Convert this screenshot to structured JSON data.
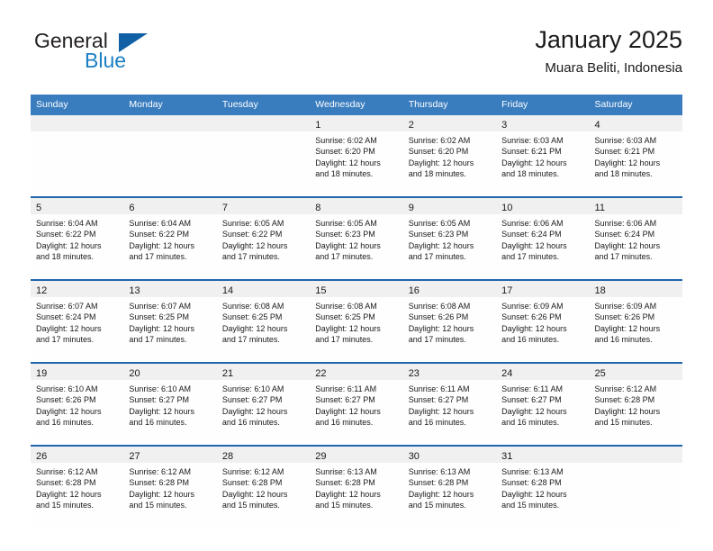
{
  "brand": {
    "name_top": "General",
    "name_bottom": "Blue",
    "accent_color": "#1160a6",
    "blue_text_color": "#1c7fc4"
  },
  "header": {
    "title": "January 2025",
    "subtitle": "Muara Beliti, Indonesia"
  },
  "calendar": {
    "header_bg": "#3a7dbf",
    "row_divider": "#1f64ad",
    "weekdays": [
      "Sunday",
      "Monday",
      "Tuesday",
      "Wednesday",
      "Thursday",
      "Friday",
      "Saturday"
    ],
    "weeks": [
      [
        {
          "day": "",
          "sunrise": "",
          "sunset": "",
          "daylight1": "",
          "daylight2": ""
        },
        {
          "day": "",
          "sunrise": "",
          "sunset": "",
          "daylight1": "",
          "daylight2": ""
        },
        {
          "day": "",
          "sunrise": "",
          "sunset": "",
          "daylight1": "",
          "daylight2": ""
        },
        {
          "day": "1",
          "sunrise": "Sunrise: 6:02 AM",
          "sunset": "Sunset: 6:20 PM",
          "daylight1": "Daylight: 12 hours",
          "daylight2": "and 18 minutes."
        },
        {
          "day": "2",
          "sunrise": "Sunrise: 6:02 AM",
          "sunset": "Sunset: 6:20 PM",
          "daylight1": "Daylight: 12 hours",
          "daylight2": "and 18 minutes."
        },
        {
          "day": "3",
          "sunrise": "Sunrise: 6:03 AM",
          "sunset": "Sunset: 6:21 PM",
          "daylight1": "Daylight: 12 hours",
          "daylight2": "and 18 minutes."
        },
        {
          "day": "4",
          "sunrise": "Sunrise: 6:03 AM",
          "sunset": "Sunset: 6:21 PM",
          "daylight1": "Daylight: 12 hours",
          "daylight2": "and 18 minutes."
        }
      ],
      [
        {
          "day": "5",
          "sunrise": "Sunrise: 6:04 AM",
          "sunset": "Sunset: 6:22 PM",
          "daylight1": "Daylight: 12 hours",
          "daylight2": "and 18 minutes."
        },
        {
          "day": "6",
          "sunrise": "Sunrise: 6:04 AM",
          "sunset": "Sunset: 6:22 PM",
          "daylight1": "Daylight: 12 hours",
          "daylight2": "and 17 minutes."
        },
        {
          "day": "7",
          "sunrise": "Sunrise: 6:05 AM",
          "sunset": "Sunset: 6:22 PM",
          "daylight1": "Daylight: 12 hours",
          "daylight2": "and 17 minutes."
        },
        {
          "day": "8",
          "sunrise": "Sunrise: 6:05 AM",
          "sunset": "Sunset: 6:23 PM",
          "daylight1": "Daylight: 12 hours",
          "daylight2": "and 17 minutes."
        },
        {
          "day": "9",
          "sunrise": "Sunrise: 6:05 AM",
          "sunset": "Sunset: 6:23 PM",
          "daylight1": "Daylight: 12 hours",
          "daylight2": "and 17 minutes."
        },
        {
          "day": "10",
          "sunrise": "Sunrise: 6:06 AM",
          "sunset": "Sunset: 6:24 PM",
          "daylight1": "Daylight: 12 hours",
          "daylight2": "and 17 minutes."
        },
        {
          "day": "11",
          "sunrise": "Sunrise: 6:06 AM",
          "sunset": "Sunset: 6:24 PM",
          "daylight1": "Daylight: 12 hours",
          "daylight2": "and 17 minutes."
        }
      ],
      [
        {
          "day": "12",
          "sunrise": "Sunrise: 6:07 AM",
          "sunset": "Sunset: 6:24 PM",
          "daylight1": "Daylight: 12 hours",
          "daylight2": "and 17 minutes."
        },
        {
          "day": "13",
          "sunrise": "Sunrise: 6:07 AM",
          "sunset": "Sunset: 6:25 PM",
          "daylight1": "Daylight: 12 hours",
          "daylight2": "and 17 minutes."
        },
        {
          "day": "14",
          "sunrise": "Sunrise: 6:08 AM",
          "sunset": "Sunset: 6:25 PM",
          "daylight1": "Daylight: 12 hours",
          "daylight2": "and 17 minutes."
        },
        {
          "day": "15",
          "sunrise": "Sunrise: 6:08 AM",
          "sunset": "Sunset: 6:25 PM",
          "daylight1": "Daylight: 12 hours",
          "daylight2": "and 17 minutes."
        },
        {
          "day": "16",
          "sunrise": "Sunrise: 6:08 AM",
          "sunset": "Sunset: 6:26 PM",
          "daylight1": "Daylight: 12 hours",
          "daylight2": "and 17 minutes."
        },
        {
          "day": "17",
          "sunrise": "Sunrise: 6:09 AM",
          "sunset": "Sunset: 6:26 PM",
          "daylight1": "Daylight: 12 hours",
          "daylight2": "and 16 minutes."
        },
        {
          "day": "18",
          "sunrise": "Sunrise: 6:09 AM",
          "sunset": "Sunset: 6:26 PM",
          "daylight1": "Daylight: 12 hours",
          "daylight2": "and 16 minutes."
        }
      ],
      [
        {
          "day": "19",
          "sunrise": "Sunrise: 6:10 AM",
          "sunset": "Sunset: 6:26 PM",
          "daylight1": "Daylight: 12 hours",
          "daylight2": "and 16 minutes."
        },
        {
          "day": "20",
          "sunrise": "Sunrise: 6:10 AM",
          "sunset": "Sunset: 6:27 PM",
          "daylight1": "Daylight: 12 hours",
          "daylight2": "and 16 minutes."
        },
        {
          "day": "21",
          "sunrise": "Sunrise: 6:10 AM",
          "sunset": "Sunset: 6:27 PM",
          "daylight1": "Daylight: 12 hours",
          "daylight2": "and 16 minutes."
        },
        {
          "day": "22",
          "sunrise": "Sunrise: 6:11 AM",
          "sunset": "Sunset: 6:27 PM",
          "daylight1": "Daylight: 12 hours",
          "daylight2": "and 16 minutes."
        },
        {
          "day": "23",
          "sunrise": "Sunrise: 6:11 AM",
          "sunset": "Sunset: 6:27 PM",
          "daylight1": "Daylight: 12 hours",
          "daylight2": "and 16 minutes."
        },
        {
          "day": "24",
          "sunrise": "Sunrise: 6:11 AM",
          "sunset": "Sunset: 6:27 PM",
          "daylight1": "Daylight: 12 hours",
          "daylight2": "and 16 minutes."
        },
        {
          "day": "25",
          "sunrise": "Sunrise: 6:12 AM",
          "sunset": "Sunset: 6:28 PM",
          "daylight1": "Daylight: 12 hours",
          "daylight2": "and 15 minutes."
        }
      ],
      [
        {
          "day": "26",
          "sunrise": "Sunrise: 6:12 AM",
          "sunset": "Sunset: 6:28 PM",
          "daylight1": "Daylight: 12 hours",
          "daylight2": "and 15 minutes."
        },
        {
          "day": "27",
          "sunrise": "Sunrise: 6:12 AM",
          "sunset": "Sunset: 6:28 PM",
          "daylight1": "Daylight: 12 hours",
          "daylight2": "and 15 minutes."
        },
        {
          "day": "28",
          "sunrise": "Sunrise: 6:12 AM",
          "sunset": "Sunset: 6:28 PM",
          "daylight1": "Daylight: 12 hours",
          "daylight2": "and 15 minutes."
        },
        {
          "day": "29",
          "sunrise": "Sunrise: 6:13 AM",
          "sunset": "Sunset: 6:28 PM",
          "daylight1": "Daylight: 12 hours",
          "daylight2": "and 15 minutes."
        },
        {
          "day": "30",
          "sunrise": "Sunrise: 6:13 AM",
          "sunset": "Sunset: 6:28 PM",
          "daylight1": "Daylight: 12 hours",
          "daylight2": "and 15 minutes."
        },
        {
          "day": "31",
          "sunrise": "Sunrise: 6:13 AM",
          "sunset": "Sunset: 6:28 PM",
          "daylight1": "Daylight: 12 hours",
          "daylight2": "and 15 minutes."
        },
        {
          "day": "",
          "sunrise": "",
          "sunset": "",
          "daylight1": "",
          "daylight2": ""
        }
      ]
    ]
  }
}
